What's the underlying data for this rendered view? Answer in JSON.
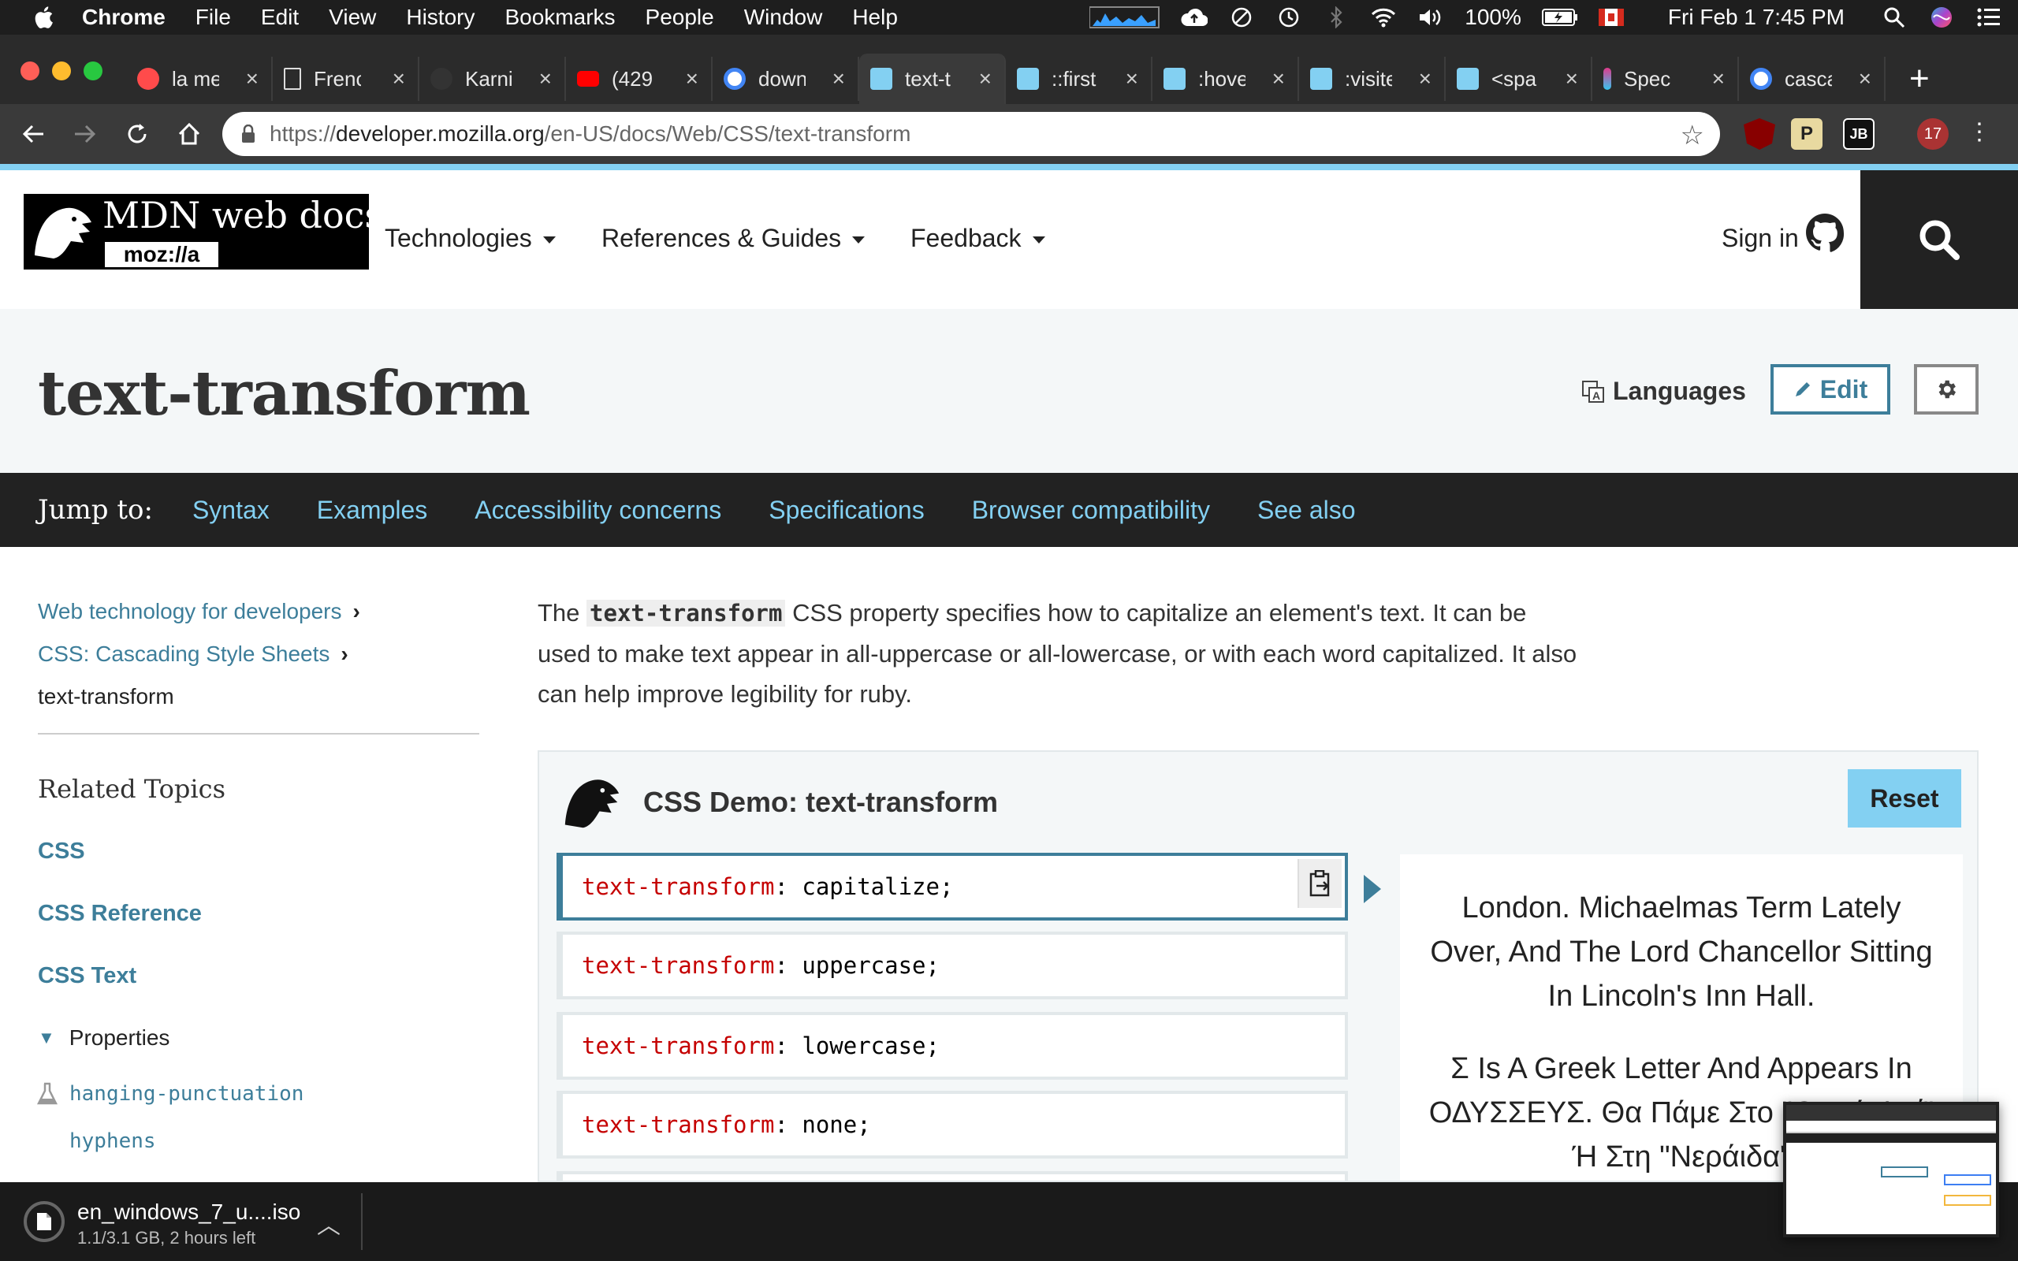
{
  "menubar": {
    "app": "Chrome",
    "items": [
      "File",
      "Edit",
      "View",
      "History",
      "Bookmarks",
      "People",
      "Window",
      "Help"
    ],
    "battery": "100%",
    "datetime": "Fri Feb 1  7:45 PM"
  },
  "tabs": [
    {
      "title": "la me",
      "color": "#ff4b4b"
    },
    {
      "title": "Frenc",
      "color": "#ddd"
    },
    {
      "title": "Karni",
      "color": "#333"
    },
    {
      "title": "(429",
      "color": "#ff0000"
    },
    {
      "title": "down",
      "color": "#4285f4"
    },
    {
      "title": "text-t",
      "color": "#83d0f2",
      "active": true
    },
    {
      "title": "::first",
      "color": "#83d0f2"
    },
    {
      "title": ":hove",
      "color": "#83d0f2"
    },
    {
      "title": ":visite",
      "color": "#83d0f2"
    },
    {
      "title": "<spa",
      "color": "#83d0f2"
    },
    {
      "title": "Spec",
      "color": "#e03a8c"
    },
    {
      "title": "casca",
      "color": "#4285f4"
    }
  ],
  "address": {
    "scheme": "https://",
    "host": "developer.mozilla.org",
    "path": "/en-US/docs/Web/CSS/text-transform"
  },
  "extensions": {
    "badge": "17",
    "p": "P",
    "jb": "JB"
  },
  "mdn": {
    "logo_text": "MDN web docs",
    "logo_sub": "moz://a",
    "nav": [
      "Technologies",
      "References & Guides",
      "Feedback"
    ],
    "signin": "Sign in"
  },
  "page": {
    "title": "text-transform",
    "languages": "Languages",
    "edit": "Edit"
  },
  "jump": {
    "label": "Jump to:",
    "links": [
      "Syntax",
      "Examples",
      "Accessibility concerns",
      "Specifications",
      "Browser compatibility",
      "See also"
    ]
  },
  "sidebar": {
    "breadcrumbs": [
      "Web technology for developers",
      "CSS: Cascading Style Sheets",
      "text-transform"
    ],
    "related": "Related Topics",
    "topics": [
      "CSS",
      "CSS Reference",
      "CSS Text"
    ],
    "properties": "Properties",
    "property_links": [
      "hanging-punctuation",
      "hyphens"
    ]
  },
  "intro": {
    "before": "The ",
    "code": "text-transform",
    "after": " CSS property specifies how to capitalize an element's text. It can be used to make text appear in all-uppercase or all-lowercase, or with each word capitalized. It also can help improve legibility for ruby."
  },
  "demo": {
    "title": "CSS Demo: text-transform",
    "reset": "Reset",
    "property": "text-transform",
    "choices": [
      "capitalize;",
      "uppercase;",
      "lowercase;",
      "none;"
    ],
    "output": [
      "London. Michaelmas Term Lately Over, And The Lord Chancellor Sitting In Lincoln's Inn Hall.",
      "Σ Is A Greek Letter And Appears In ΟΔΥΣΣΕΥΣ. Θα Πάμε Στο \"Θεϊκό Φαΐ\" Ή Στη \"Νεράιδα\""
    ]
  },
  "download": {
    "filename": "en_windows_7_u....iso",
    "status": "1.1/3.1 GB, 2 hours left"
  }
}
